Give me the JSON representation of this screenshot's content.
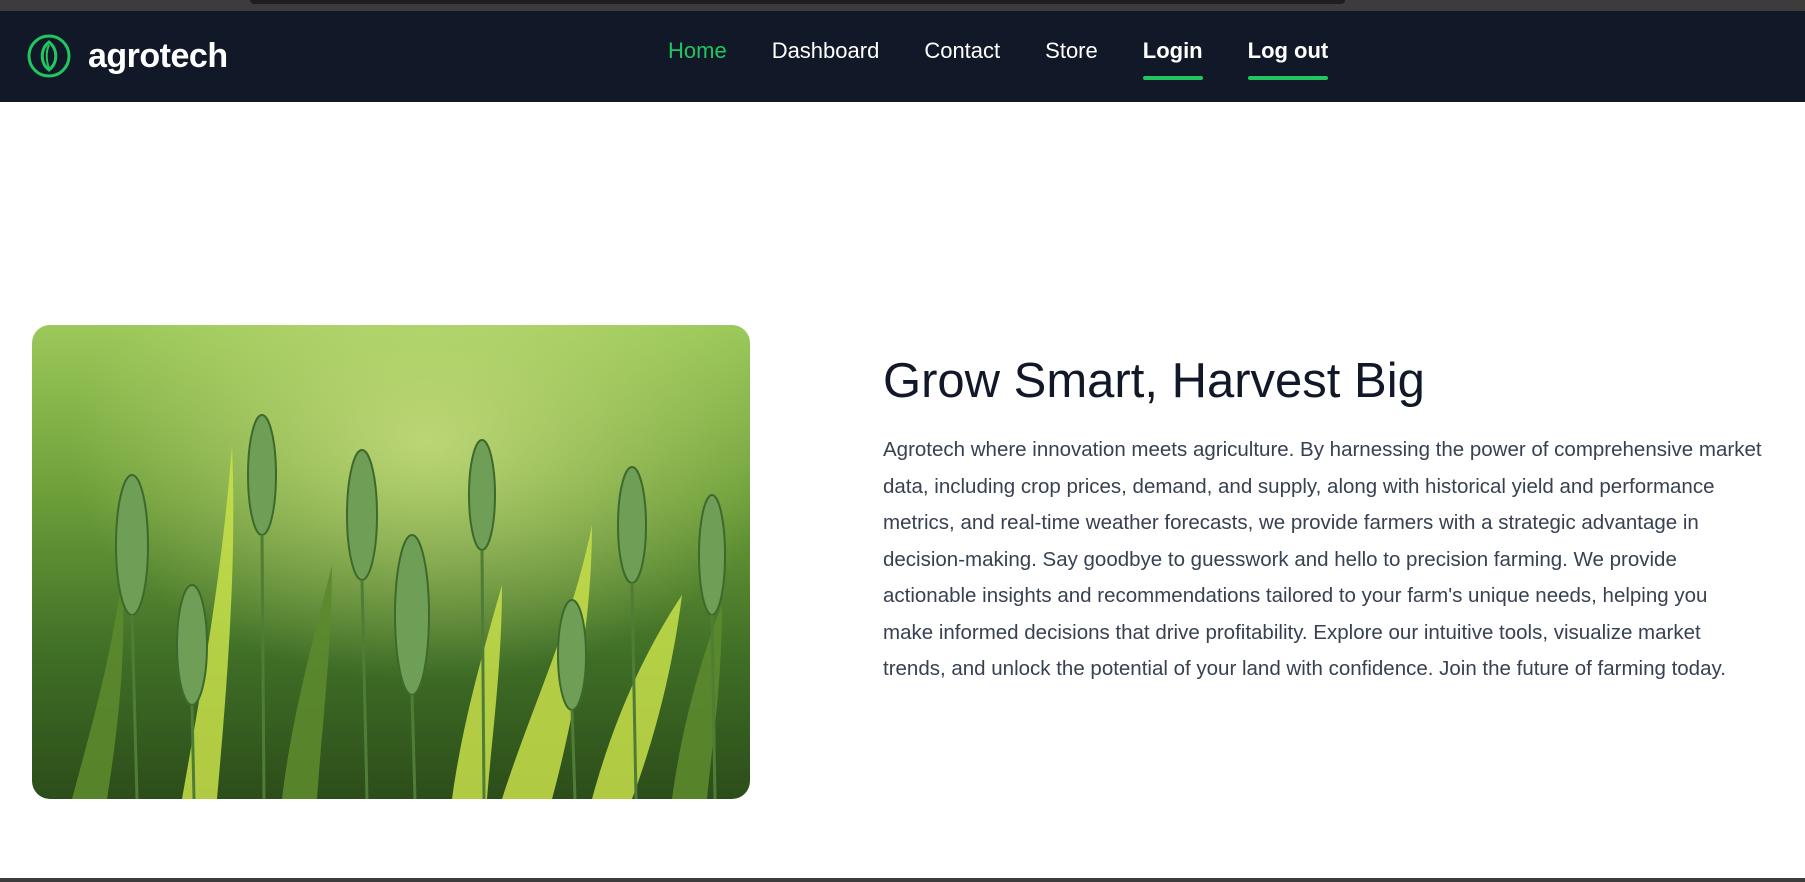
{
  "brand": {
    "name": "agrotech",
    "accent": "#22c55e",
    "navbar_bg": "#111827"
  },
  "nav": {
    "items": [
      {
        "label": "Home"
      },
      {
        "label": "Dashboard"
      },
      {
        "label": "Contact"
      },
      {
        "label": "Store"
      },
      {
        "label": "Login"
      },
      {
        "label": "Log out"
      }
    ]
  },
  "hero": {
    "image": "wheat-field-photo",
    "title": "Grow Smart, Harvest Big",
    "description": "Agrotech where innovation meets agriculture. By harnessing the power of comprehensive market data, including crop prices, demand, and supply, along with historical yield and performance metrics, and real-time weather forecasts, we provide farmers with a strategic advantage in decision-making. Say goodbye to guesswork and hello to precision farming. We provide actionable insights and recommendations tailored to your farm's unique needs, helping you make informed decisions that drive profitability. Explore our intuitive tools, visualize market trends, and unlock the potential of your land with confidence. Join the future of farming today."
  }
}
